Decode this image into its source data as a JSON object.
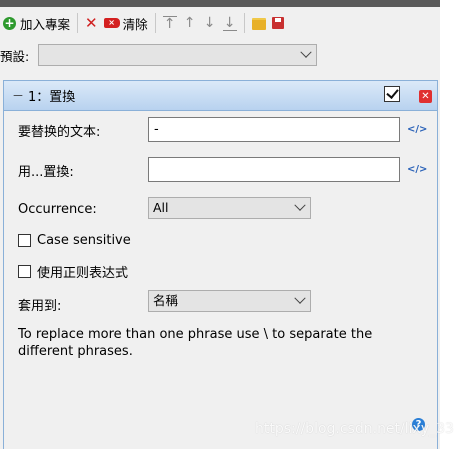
{
  "toolbar": {
    "add_label": "加入專案",
    "clear_label": "清除"
  },
  "preset": {
    "label": "預設:",
    "value": ""
  },
  "panel": {
    "collapse_glyph": "－",
    "title": "1：置換",
    "enabled": true,
    "find_label": "要替换的文本:",
    "find_value": "-",
    "replace_label": "用...置換:",
    "replace_value": "",
    "occurrence_label": "Occurrence:",
    "occurrence_value": "All",
    "case_sensitive_label": "Case sensitive",
    "case_sensitive_checked": false,
    "regex_label": "使用正则表达式",
    "regex_checked": false,
    "apply_to_label": "套用到:",
    "apply_to_value": "名稱",
    "hint": "To replace more than one phrase use \\ to separate the different phrases."
  },
  "watermark": "https://blog.csdn.net/lixy_33",
  "colors": {
    "header_gradient_top": "#dbe9f8",
    "header_gradient_bottom": "#b8d2ef",
    "panel_border": "#8ab0d8",
    "remove_red": "#e03030",
    "add_green": "#2e9a2e"
  }
}
